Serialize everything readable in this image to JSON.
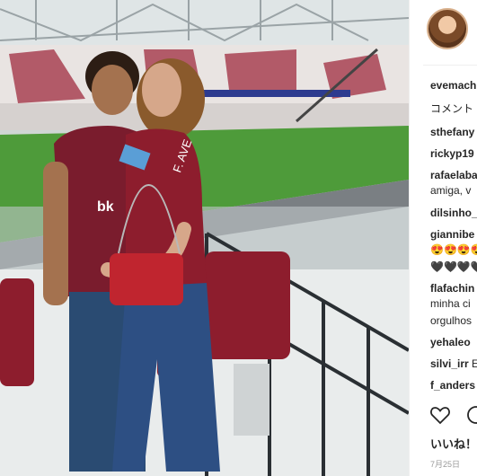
{
  "post": {
    "username": "evemach",
    "caption_label": "コメント",
    "likes_label": "いいね！",
    "date": "7月25日"
  },
  "comments": [
    {
      "user": "sthefany",
      "text": ""
    },
    {
      "user": "rickyp19",
      "text": ""
    },
    {
      "user": "rafaelaba",
      "text": "amiga, v"
    },
    {
      "user": "dilsinho_",
      "text": ""
    },
    {
      "user": "giannibe",
      "text": "😍😍😍😍"
    },
    {
      "user": "",
      "text": "🖤🖤🖤🖤"
    },
    {
      "user": "flafachin",
      "text": "minha ci"
    },
    {
      "user": "",
      "text": "orgulhos"
    },
    {
      "user": "yehaleo",
      "text": ""
    },
    {
      "user": "silvi_irr",
      "text": "E"
    },
    {
      "user": "f_anders",
      "text": ""
    }
  ],
  "jersey_text": "F. AVE",
  "sponsor_text": "bk"
}
